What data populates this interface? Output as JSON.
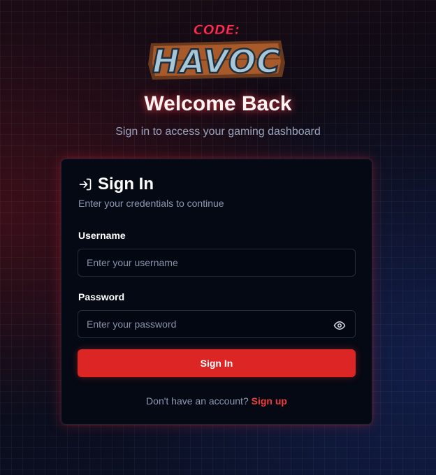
{
  "logo": {
    "line1": "CODE:",
    "line2": "HAVOC"
  },
  "header": {
    "title": "Welcome Back",
    "subtitle": "Sign in to access your gaming dashboard"
  },
  "card": {
    "icon": "sign-in-icon",
    "title": "Sign In",
    "description": "Enter your credentials to continue",
    "username": {
      "label": "Username",
      "placeholder": "Enter your username",
      "value": ""
    },
    "password": {
      "label": "Password",
      "placeholder": "Enter your password",
      "value": "",
      "toggle_icon": "eye-icon"
    },
    "submit_label": "Sign In",
    "signup_prompt": "Don't have an account?",
    "signup_link": "Sign up"
  },
  "colors": {
    "accent": "#dc2626",
    "link": "#ef3b3b",
    "card_bg": "#050914",
    "page_bg": "#0c0b16"
  }
}
